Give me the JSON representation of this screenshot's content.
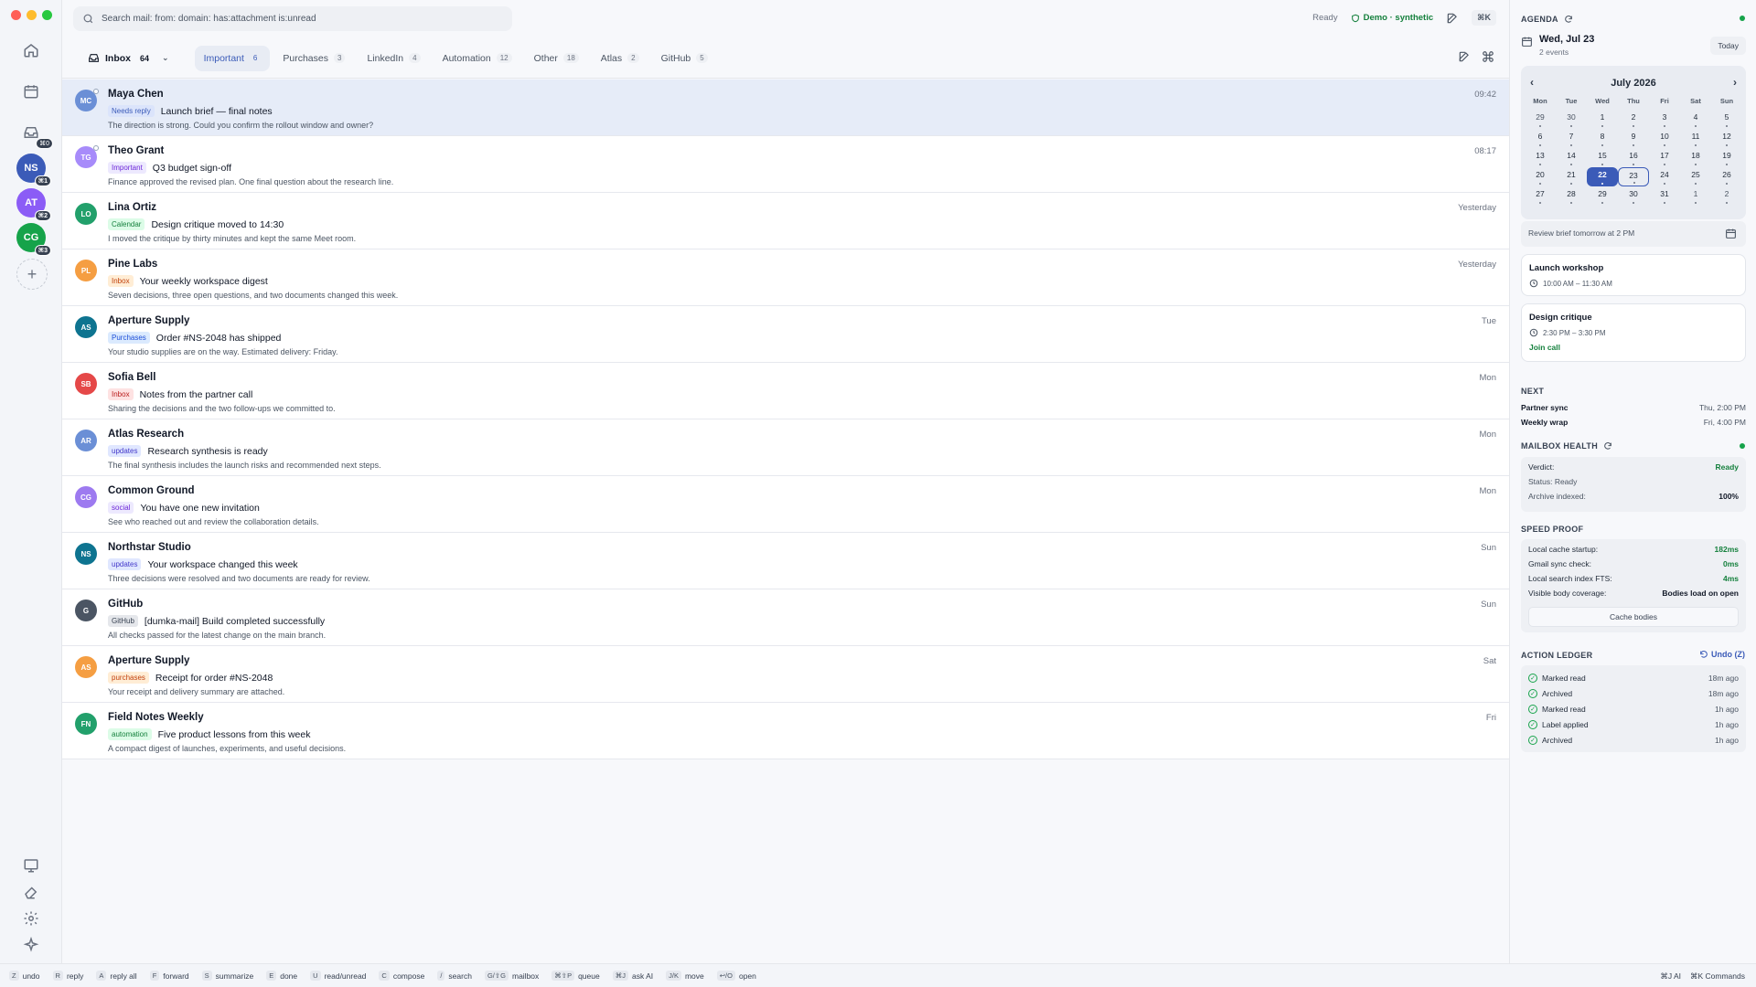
{
  "search": {
    "placeholder": "Search mail: from: domain: has:attachment is:unread"
  },
  "topbar": {
    "status": "Ready",
    "demo": "Demo · synthetic",
    "shortcut": "⌘K"
  },
  "rail": {
    "avatars": [
      {
        "initials": "NS",
        "badge": "⌘1",
        "color": "#3b5bb8"
      },
      {
        "initials": "AT",
        "badge": "⌘2",
        "color": "#8b5cf6"
      },
      {
        "initials": "CG",
        "badge": "⌘3",
        "color": "#16a34a"
      }
    ],
    "inbox_badge": "⌘0"
  },
  "tabs": [
    {
      "label": "Inbox",
      "count": "64"
    },
    {
      "label": "Important",
      "count": "6"
    },
    {
      "label": "Purchases",
      "count": "3"
    },
    {
      "label": "LinkedIn",
      "count": "4"
    },
    {
      "label": "Automation",
      "count": "12"
    },
    {
      "label": "Other",
      "count": "18"
    },
    {
      "label": "Atlas",
      "count": "2"
    },
    {
      "label": "GitHub",
      "count": "5"
    }
  ],
  "mails": [
    {
      "initials": "MC",
      "avatar_color": "#6b8fd6",
      "sender": "Maya Chen",
      "time": "09:42",
      "tag": "Needs reply",
      "tag_bg": "#dbe4fb",
      "tag_fg": "#3b5bb8",
      "subject": "Launch brief — final notes",
      "preview": "The direction is strong. Could you confirm the rollout window and owner?"
    },
    {
      "initials": "TG",
      "avatar_color": "#a78bfa",
      "sender": "Theo Grant",
      "time": "08:17",
      "tag": "Important",
      "tag_bg": "#ede9fe",
      "tag_fg": "#6d28d9",
      "subject": "Q3 budget sign-off",
      "preview": "Finance approved the revised plan. One final question about the research line."
    },
    {
      "initials": "LO",
      "avatar_color": "#22a06b",
      "sender": "Lina Ortiz",
      "time": "Yesterday",
      "tag": "Calendar",
      "tag_bg": "#dcfce7",
      "tag_fg": "#15803d",
      "subject": "Design critique moved to 14:30",
      "preview": "I moved the critique by thirty minutes and kept the same Meet room."
    },
    {
      "initials": "PL",
      "avatar_color": "#f59e42",
      "sender": "Pine Labs",
      "time": "Yesterday",
      "tag": "Inbox",
      "tag_bg": "#ffedd5",
      "tag_fg": "#c2410c",
      "subject": "Your weekly workspace digest",
      "preview": "Seven decisions, three open questions, and two documents changed this week."
    },
    {
      "initials": "AS",
      "avatar_color": "#0e7490",
      "sender": "Aperture Supply",
      "time": "Tue",
      "tag": "Purchases",
      "tag_bg": "#dbeafe",
      "tag_fg": "#1d4ed8",
      "subject": "Order #NS-2048 has shipped",
      "preview": "Your studio supplies are on the way. Estimated delivery: Friday."
    },
    {
      "initials": "SB",
      "avatar_color": "#e54848",
      "sender": "Sofia Bell",
      "time": "Mon",
      "tag": "Inbox",
      "tag_bg": "#fee2e2",
      "tag_fg": "#b91c1c",
      "subject": "Notes from the partner call",
      "preview": "Sharing the decisions and the two follow-ups we committed to."
    },
    {
      "initials": "AR",
      "avatar_color": "#6b8fd6",
      "sender": "Atlas Research",
      "time": "Mon",
      "tag": "updates",
      "tag_bg": "#e0e7ff",
      "tag_fg": "#4338ca",
      "subject": "Research synthesis is ready",
      "preview": "The final synthesis includes the launch risks and recommended next steps."
    },
    {
      "initials": "CG",
      "avatar_color": "#9d7af0",
      "sender": "Common Ground",
      "time": "Mon",
      "tag": "social",
      "tag_bg": "#ede9fe",
      "tag_fg": "#6d28d9",
      "subject": "You have one new invitation",
      "preview": "See who reached out and review the collaboration details."
    },
    {
      "initials": "NS",
      "avatar_color": "#0e7490",
      "sender": "Northstar Studio",
      "time": "Sun",
      "tag": "updates",
      "tag_bg": "#e0e7ff",
      "tag_fg": "#4338ca",
      "subject": "Your workspace changed this week",
      "preview": "Three decisions were resolved and two documents are ready for review."
    },
    {
      "initials": "G",
      "avatar_color": "#4b5563",
      "sender": "GitHub",
      "time": "Sun",
      "tag": "GitHub",
      "tag_bg": "#e5e7eb",
      "tag_fg": "#374151",
      "subject": "[dumka-mail] Build completed successfully",
      "preview": "All checks passed for the latest change on the main branch."
    },
    {
      "initials": "AS",
      "avatar_color": "#f59e42",
      "sender": "Aperture Supply",
      "time": "Sat",
      "tag": "purchases",
      "tag_bg": "#ffedd5",
      "tag_fg": "#c2410c",
      "subject": "Receipt for order #NS-2048",
      "preview": "Your receipt and delivery summary are attached."
    },
    {
      "initials": "FN",
      "avatar_color": "#22a06b",
      "sender": "Field Notes Weekly",
      "time": "Fri",
      "tag": "automation",
      "tag_bg": "#dcfce7",
      "tag_fg": "#15803d",
      "subject": "Five product lessons from this week",
      "preview": "A compact digest of launches, experiments, and useful decisions."
    }
  ],
  "agenda": {
    "heading": "AGENDA",
    "date": "Wed, Jul 23",
    "events_count": "2 events",
    "today_label": "Today",
    "month": "July 2026",
    "dow": [
      "Mon",
      "Tue",
      "Wed",
      "Thu",
      "Fri",
      "Sat",
      "Sun"
    ],
    "days": [
      "29",
      "30",
      "1",
      "2",
      "3",
      "4",
      "5",
      "6",
      "7",
      "8",
      "9",
      "10",
      "11",
      "12",
      "13",
      "14",
      "15",
      "16",
      "17",
      "18",
      "19",
      "20",
      "21",
      "22",
      "23",
      "24",
      "25",
      "26",
      "27",
      "28",
      "29",
      "30",
      "31",
      "1",
      "2"
    ],
    "selected_day_index": 23,
    "today_day_index": 24,
    "review_text": "Review brief tomorrow at 2 PM",
    "events": [
      {
        "title": "Launch workshop",
        "time": "10:00 AM – 11:30 AM"
      },
      {
        "title": "Design critique",
        "time": "2:30 PM – 3:30 PM",
        "join": "Join call"
      }
    ]
  },
  "next": {
    "heading": "NEXT",
    "items": [
      {
        "label": "Partner sync",
        "when": "Thu, 2:00 PM"
      },
      {
        "label": "Weekly wrap",
        "when": "Fri, 4:00 PM"
      }
    ]
  },
  "health": {
    "heading": "MAILBOX HEALTH",
    "verdict_label": "Verdict:",
    "verdict": "Ready",
    "status": "Status: Ready",
    "archive_label": "Archive indexed:",
    "archive": "100%"
  },
  "speed": {
    "heading": "SPEED PROOF",
    "rows": [
      {
        "label": "Local cache startup:",
        "value": "182ms"
      },
      {
        "label": "Gmail sync check:",
        "value": "0ms"
      },
      {
        "label": "Local search index FTS:",
        "value": "4ms"
      },
      {
        "label": "Visible body coverage:",
        "value": "Bodies load on open"
      }
    ],
    "button": "Cache bodies"
  },
  "ledger": {
    "heading": "ACTION LEDGER",
    "undo": "Undo (Z)",
    "rows": [
      {
        "action": "Marked read",
        "ago": "18m ago"
      },
      {
        "action": "Archived",
        "ago": "18m ago"
      },
      {
        "action": "Marked read",
        "ago": "1h ago"
      },
      {
        "action": "Label applied",
        "ago": "1h ago"
      },
      {
        "action": "Archived",
        "ago": "1h ago"
      }
    ]
  },
  "shortcuts": [
    {
      "key": "Z",
      "label": "undo"
    },
    {
      "key": "R",
      "label": "reply"
    },
    {
      "key": "A",
      "label": "reply all"
    },
    {
      "key": "F",
      "label": "forward"
    },
    {
      "key": "S",
      "label": "summarize"
    },
    {
      "key": "E",
      "label": "done"
    },
    {
      "key": "U",
      "label": "read/unread"
    },
    {
      "key": "C",
      "label": "compose"
    },
    {
      "key": "/",
      "label": "search"
    },
    {
      "key": "G/⇧G",
      "label": "mailbox"
    },
    {
      "key": "⌘⇧P",
      "label": "queue"
    },
    {
      "key": "⌘J",
      "label": "ask AI"
    },
    {
      "key": "J/K",
      "label": "move"
    },
    {
      "key": "↩/O",
      "label": "open"
    }
  ],
  "bottom_right": [
    "⌘J AI",
    "⌘K Commands"
  ]
}
